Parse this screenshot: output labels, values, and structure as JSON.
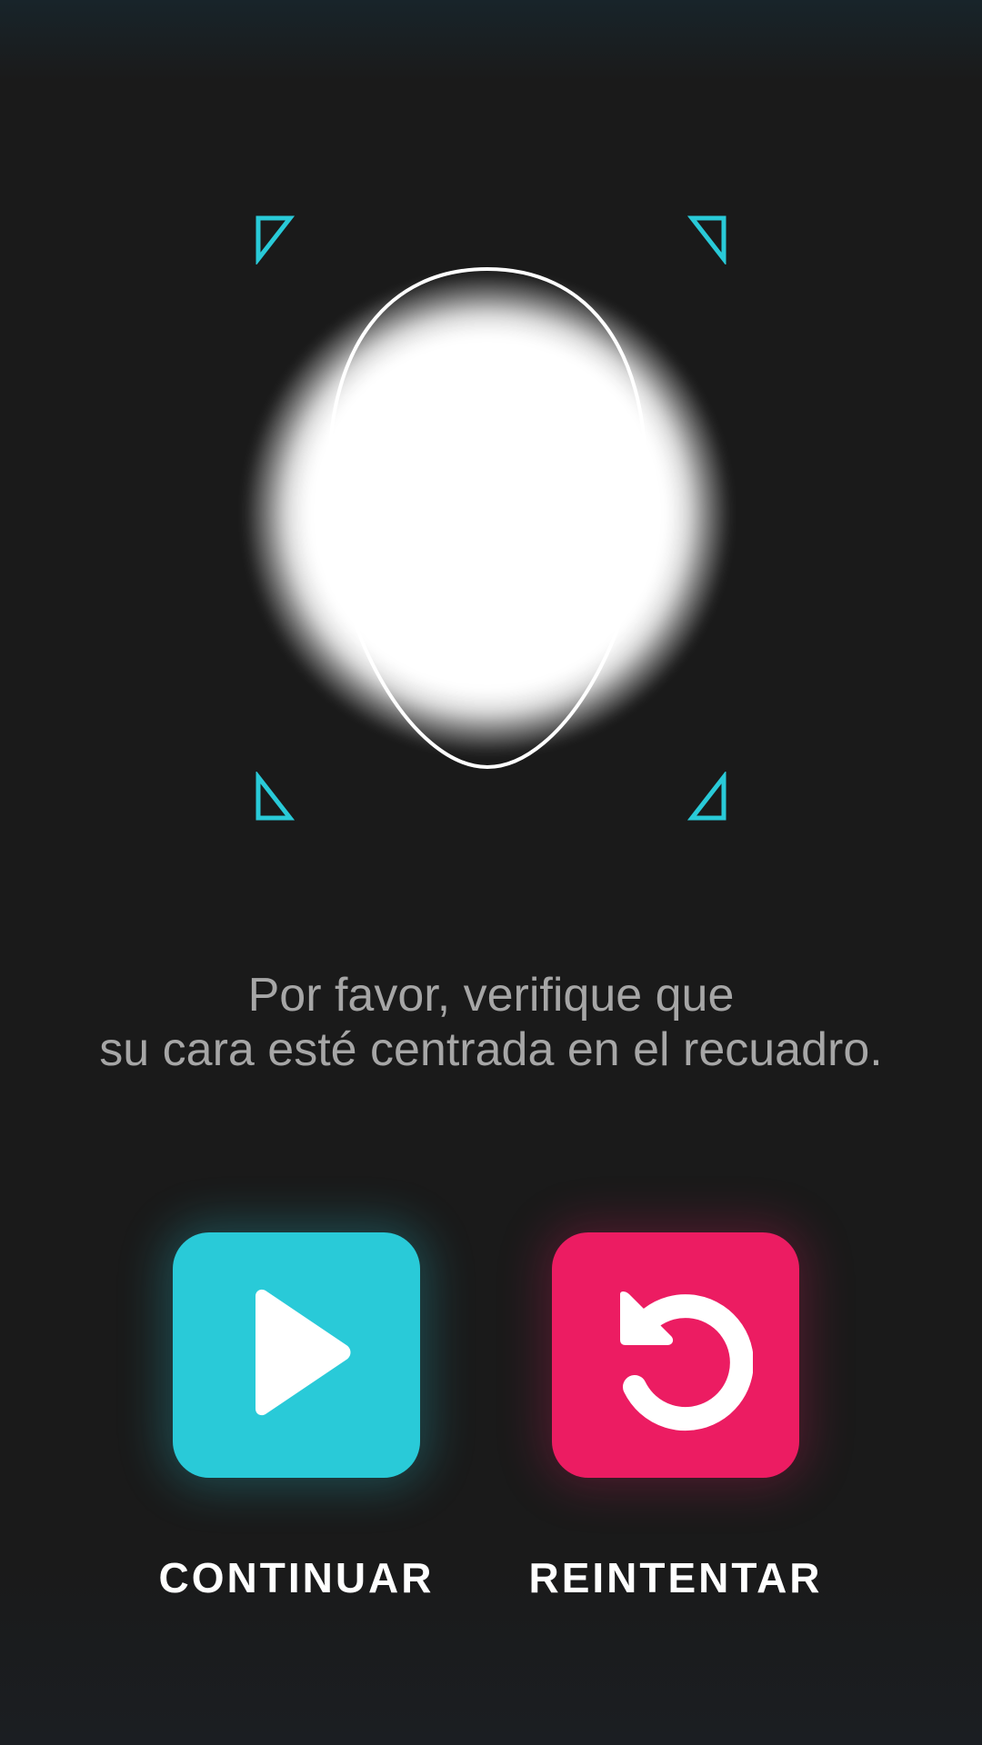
{
  "instruction": {
    "line1": "Por favor, verifique que",
    "line2": "su cara esté centrada en el recuadro."
  },
  "actions": {
    "continue_label": "CONTINUAR",
    "retry_label": "REINTENTAR"
  },
  "icons": {
    "continue": "play-icon",
    "retry": "retry-icon",
    "frame_corners": "corner-marker-icon"
  },
  "colors": {
    "background": "#1a1a1a",
    "accent_cyan": "#29cad8",
    "accent_pink": "#ec1c62",
    "instruction_text": "#a6a6a6",
    "label_text": "#ffffff"
  }
}
